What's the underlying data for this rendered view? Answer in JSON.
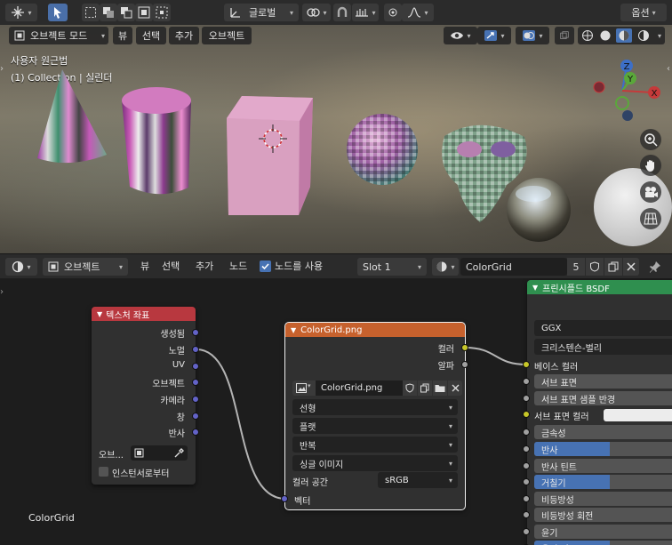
{
  "top_header": {
    "transform_orientation": "글로벌",
    "options": "옵션"
  },
  "viewport": {
    "mode": "오브젝트 모드",
    "menus": [
      "뷰",
      "선택",
      "추가",
      "오브젝트"
    ],
    "info_line1": "사용자 원근법",
    "info_line2": "(1) Collection | 실린더",
    "gizmo": {
      "z": "Z",
      "y": "Y",
      "x": "X"
    }
  },
  "node_header": {
    "editor_type": "오브젝트",
    "menus": [
      "뷰",
      "선택",
      "추가",
      "노드"
    ],
    "use_nodes_label": "노드를 사용",
    "use_nodes_checked": true,
    "slot": "Slot 1",
    "material_name": "ColorGrid",
    "user_count": "5"
  },
  "canvas": {
    "material_label": "ColorGrid"
  },
  "colors": {
    "texcoord_header": "#b8383f",
    "image_header": "#c6612d",
    "bsdf_header": "#2f8f4f",
    "socket_vector": "#6363c7",
    "socket_color": "#c7c729",
    "socket_float": "#a1a1a1",
    "selected_outline": "#f0f0f0",
    "slider_fill": "#4772b3"
  },
  "texcoord_node": {
    "title": "텍스처 좌표",
    "outputs": [
      "생성됨",
      "노멀",
      "UV",
      "오브젝트",
      "카메라",
      "창",
      "반사"
    ],
    "object_label": "오브...",
    "from_instancer_label": "인스턴서로부터"
  },
  "image_node": {
    "title": "ColorGrid.png",
    "outputs": [
      "컬러",
      "알파"
    ],
    "image_name": "ColorGrid.png",
    "interpolation": "선형",
    "projection": "플랫",
    "extension": "반복",
    "source": "싱글 이미지",
    "color_space_label": "컬러 공간",
    "color_space": "sRGB",
    "vector_input": "벡터"
  },
  "bsdf_node": {
    "title": "프린시플드 BSDF",
    "distribution": "GGX",
    "subsurface_method": "크리스텐슨-벌리",
    "base_color_label": "베이스 컬러",
    "subsurface_color_label": "서브 표면 컬러",
    "fields": [
      {
        "label": "서브 표면",
        "fill": 0.0
      },
      {
        "label": "서브 표면 샘플 반경",
        "fill": 0.0
      },
      {
        "label": "금속성",
        "fill": 0.0
      },
      {
        "label": "반사",
        "fill": 0.5
      },
      {
        "label": "반사 틴트",
        "fill": 0.0
      },
      {
        "label": "거칠기",
        "fill": 0.5
      },
      {
        "label": "비등방성",
        "fill": 0.0
      },
      {
        "label": "비등방성 회전",
        "fill": 0.0
      },
      {
        "label": "윤기",
        "fill": 0.0
      },
      {
        "label": "윤기 틴트",
        "fill": 0.5
      }
    ],
    "value_glyph": "0"
  }
}
